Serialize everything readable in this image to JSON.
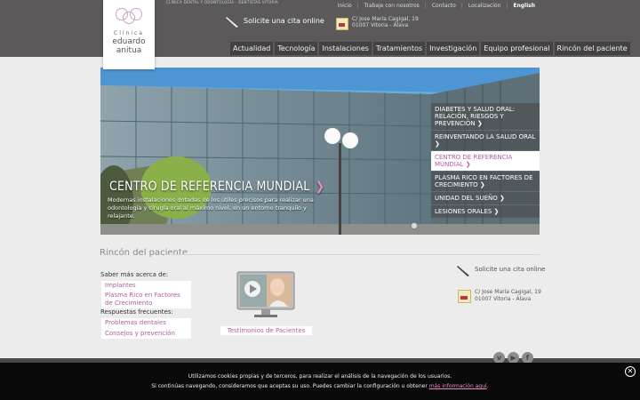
{
  "header": {
    "logo": {
      "line1": "Clínica",
      "line2": "eduardo",
      "line3": "anitua"
    },
    "tagline": "CLÍNICA DENTAL Y ODONTOLOGÍA - DENTISTAS VITORIA",
    "cita": "Solicite una cita online",
    "address": {
      "line1": "C/ Jose María Cagigal, 19",
      "line2": "01007 Vitoria - Álava"
    },
    "top_nav": [
      "Inicio",
      "Trabaje con nosotros",
      "Contacto",
      "Localización"
    ],
    "language": "English",
    "main_nav": [
      "Actualidad",
      "Tecnología",
      "Instalaciones",
      "Tratamientos",
      "Investigación",
      "Equipo profesional",
      "Rincón del paciente"
    ]
  },
  "slider": {
    "title": "CENTRO DE REFERENCIA MUNDIAL",
    "title_arrow": "❯",
    "text": "Modernas instalaciones dotadas de los útiles precisos para realizar una odontología y cirugía oral al máximo nivel, en un entorno tranquilo y relajante.",
    "menu": [
      "Diabetes y salud oral: relación, riesgos y prevención",
      "Reinventando la salud oral",
      "Centro de referencia mundial",
      "Plasma rico en factores de crecimiento",
      "Unidad del sueño",
      "Lesiones orales"
    ],
    "active_index": 2,
    "menu_arrow": "❯"
  },
  "rincon": {
    "title": "Rincón del paciente",
    "saber_title": "Saber más acerca de:",
    "saber_links": [
      "Implantes",
      "Plasma Rico en Factores de Crecimiento"
    ],
    "resp_title": "Respuestas frecuentes:",
    "resp_links": [
      "Problemas dentales comunes",
      "Consejos y prevención"
    ],
    "testimonios": "Testimonios de Pacientes"
  },
  "sidebar": {
    "cita": "Solicite una cita online",
    "address": {
      "line1": "C/ Jose María Cagigal, 19",
      "line2": "01007 Vitoria - Álava"
    }
  },
  "social": [
    "vimeo",
    "youtube",
    "facebook"
  ],
  "cookie": {
    "line1": "Utilizamos cookies propias y de terceros, para realizar el análisis de la navegación de los usuarios.",
    "line2": "Si continúas navegando, consideramos que aceptas su uso. Puedes cambiar la configuración u obtener ",
    "link": "más información aquí",
    "line2_end": ".",
    "close": "✕"
  },
  "colors": {
    "accent": "#b15ca0",
    "header_bg": "#5b595a",
    "nav_bg": "#434142"
  }
}
